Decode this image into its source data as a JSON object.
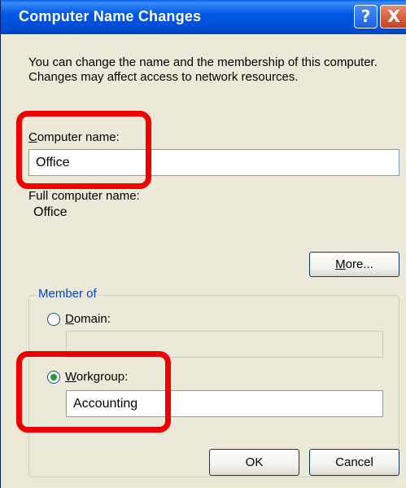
{
  "window": {
    "title": "Computer Name Changes",
    "help_glyph": "?",
    "close_glyph": "X"
  },
  "description": "You can change the name and the membership of this computer. Changes may affect access to network resources.",
  "computer_name": {
    "label_first": "C",
    "label_rest": "omputer name:",
    "value": "Office"
  },
  "full_computer_name": {
    "label": "Full computer name:",
    "value": "Office"
  },
  "more_button": {
    "label_first": "M",
    "label_rest": "ore..."
  },
  "member_of": {
    "title": "Member of",
    "domain": {
      "label_first": "D",
      "label_rest": "omain:",
      "value": "",
      "selected": false
    },
    "workgroup": {
      "label_first": "W",
      "label_rest": "orkgroup:",
      "value": "Accounting",
      "selected": true
    }
  },
  "buttons": {
    "ok": "OK",
    "cancel": "Cancel"
  },
  "colors": {
    "titlebar": "#0054e3",
    "dialog_bg": "#ece9d8",
    "group_title": "#0046d5",
    "annotation": "#ee0000",
    "radio_selected": "#21a121"
  }
}
